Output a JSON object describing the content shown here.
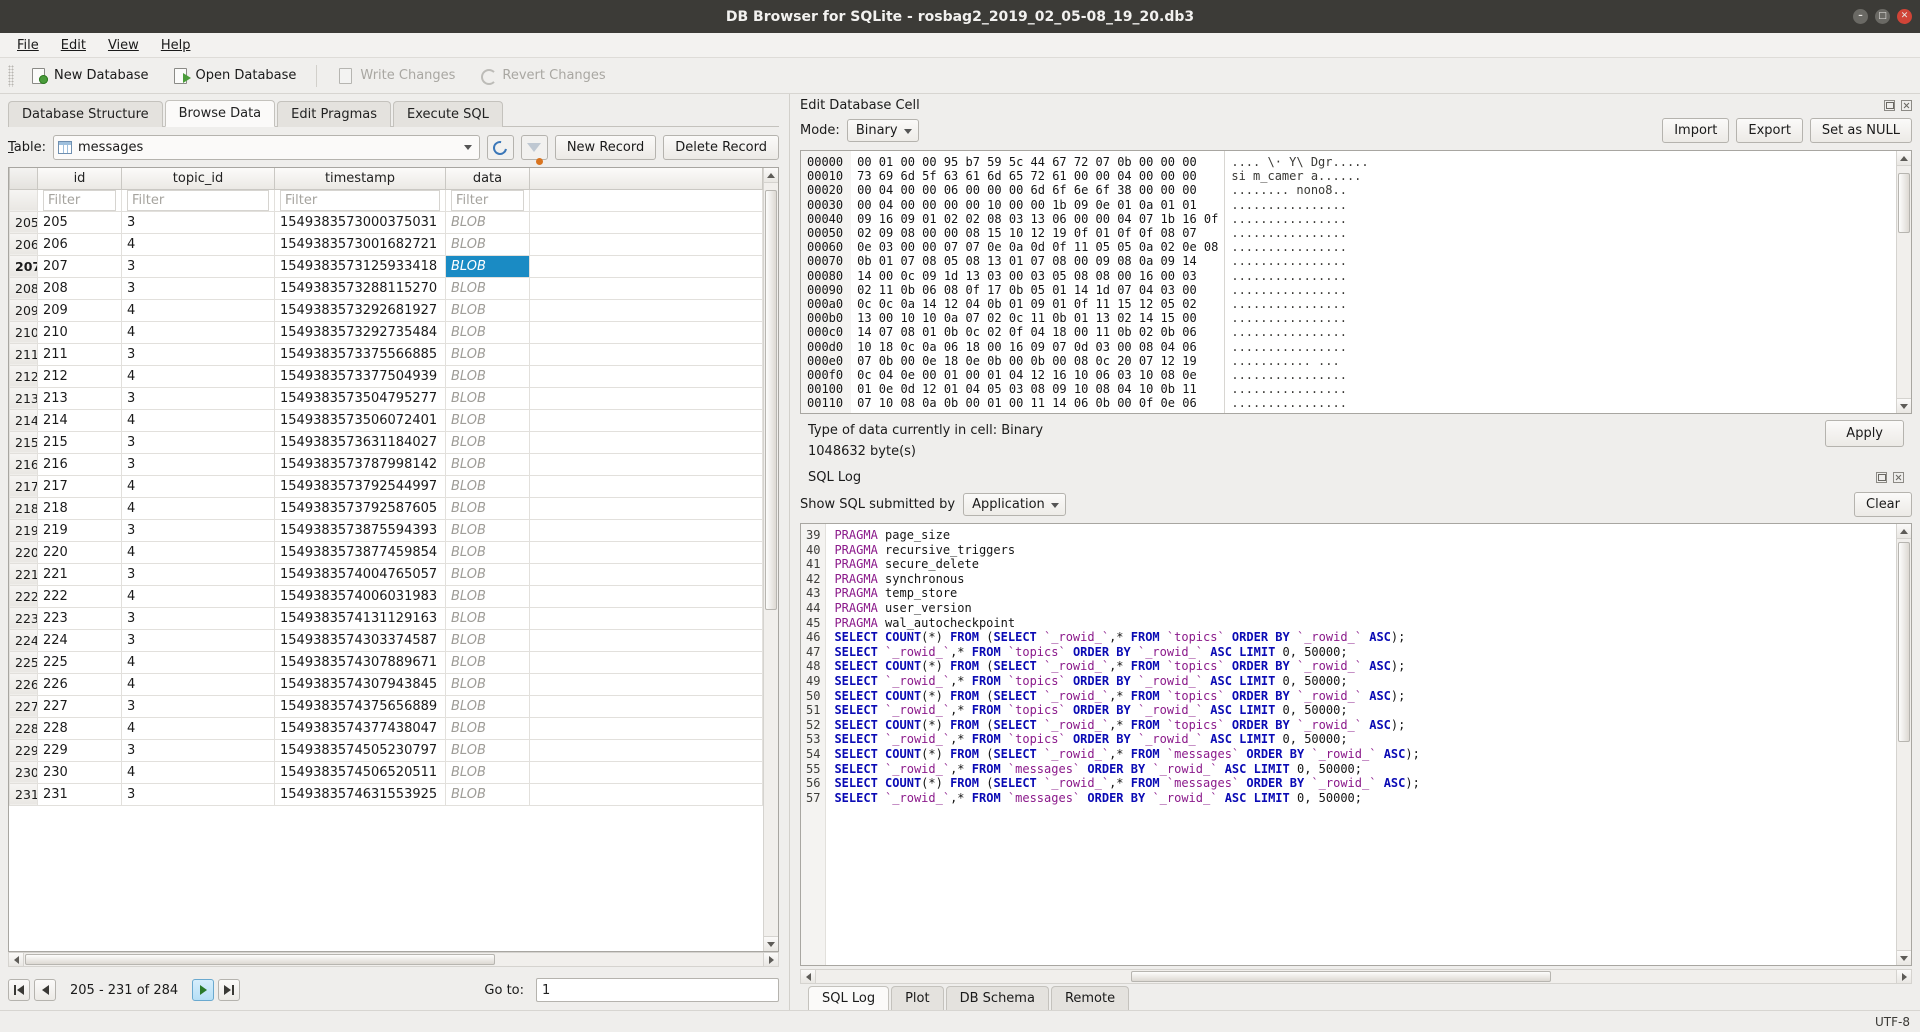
{
  "window": {
    "title": "DB Browser for SQLite - rosbag2_2019_02_05-08_19_20.db3",
    "minimize": "–",
    "maximize": "□",
    "close": "✕"
  },
  "menu": [
    {
      "label": "File",
      "mnemonic": "F"
    },
    {
      "label": "Edit",
      "mnemonic": "E"
    },
    {
      "label": "View",
      "mnemonic": "V"
    },
    {
      "label": "Help",
      "mnemonic": "H"
    }
  ],
  "toolbar": {
    "new_database": "New Database",
    "open_database": "Open Database",
    "write_changes": "Write Changes",
    "revert_changes": "Revert Changes"
  },
  "tabs": [
    {
      "label": "Database Structure",
      "active": false
    },
    {
      "label": "Browse Data",
      "active": true
    },
    {
      "label": "Edit Pragmas",
      "active": false
    },
    {
      "label": "Execute SQL",
      "active": false
    }
  ],
  "browse": {
    "table_label": "Table:",
    "table_value": "messages",
    "refresh_title": "refresh-icon",
    "filter_title": "clear-filters-icon",
    "new_record": "New Record",
    "delete_record": "Delete Record",
    "columns": [
      "id",
      "topic_id",
      "timestamp",
      "data"
    ],
    "filter_placeholder": "Filter",
    "rows": [
      {
        "n": "205",
        "id": "205",
        "topic_id": "3",
        "timestamp": "1549383573000375031",
        "data": "BLOB",
        "selected": false
      },
      {
        "n": "206",
        "id": "206",
        "topic_id": "4",
        "timestamp": "1549383573001682721",
        "data": "BLOB",
        "selected": false
      },
      {
        "n": "207",
        "id": "207",
        "topic_id": "3",
        "timestamp": "1549383573125933418",
        "data": "BLOB",
        "selected": true
      },
      {
        "n": "208",
        "id": "208",
        "topic_id": "3",
        "timestamp": "1549383573288115270",
        "data": "BLOB",
        "selected": false
      },
      {
        "n": "209",
        "id": "209",
        "topic_id": "4",
        "timestamp": "1549383573292681927",
        "data": "BLOB",
        "selected": false
      },
      {
        "n": "210",
        "id": "210",
        "topic_id": "4",
        "timestamp": "1549383573292735484",
        "data": "BLOB",
        "selected": false
      },
      {
        "n": "211",
        "id": "211",
        "topic_id": "3",
        "timestamp": "1549383573375566885",
        "data": "BLOB",
        "selected": false
      },
      {
        "n": "212",
        "id": "212",
        "topic_id": "4",
        "timestamp": "1549383573377504939",
        "data": "BLOB",
        "selected": false
      },
      {
        "n": "213",
        "id": "213",
        "topic_id": "3",
        "timestamp": "1549383573504795277",
        "data": "BLOB",
        "selected": false
      },
      {
        "n": "214",
        "id": "214",
        "topic_id": "4",
        "timestamp": "1549383573506072401",
        "data": "BLOB",
        "selected": false
      },
      {
        "n": "215",
        "id": "215",
        "topic_id": "3",
        "timestamp": "1549383573631184027",
        "data": "BLOB",
        "selected": false
      },
      {
        "n": "216",
        "id": "216",
        "topic_id": "3",
        "timestamp": "1549383573787998142",
        "data": "BLOB",
        "selected": false
      },
      {
        "n": "217",
        "id": "217",
        "topic_id": "4",
        "timestamp": "1549383573792544997",
        "data": "BLOB",
        "selected": false
      },
      {
        "n": "218",
        "id": "218",
        "topic_id": "4",
        "timestamp": "1549383573792587605",
        "data": "BLOB",
        "selected": false
      },
      {
        "n": "219",
        "id": "219",
        "topic_id": "3",
        "timestamp": "1549383573875594393",
        "data": "BLOB",
        "selected": false
      },
      {
        "n": "220",
        "id": "220",
        "topic_id": "4",
        "timestamp": "1549383573877459854",
        "data": "BLOB",
        "selected": false
      },
      {
        "n": "221",
        "id": "221",
        "topic_id": "3",
        "timestamp": "1549383574004765057",
        "data": "BLOB",
        "selected": false
      },
      {
        "n": "222",
        "id": "222",
        "topic_id": "4",
        "timestamp": "1549383574006031983",
        "data": "BLOB",
        "selected": false
      },
      {
        "n": "223",
        "id": "223",
        "topic_id": "3",
        "timestamp": "1549383574131129163",
        "data": "BLOB",
        "selected": false
      },
      {
        "n": "224",
        "id": "224",
        "topic_id": "3",
        "timestamp": "1549383574303374587",
        "data": "BLOB",
        "selected": false
      },
      {
        "n": "225",
        "id": "225",
        "topic_id": "4",
        "timestamp": "1549383574307889671",
        "data": "BLOB",
        "selected": false
      },
      {
        "n": "226",
        "id": "226",
        "topic_id": "4",
        "timestamp": "1549383574307943845",
        "data": "BLOB",
        "selected": false
      },
      {
        "n": "227",
        "id": "227",
        "topic_id": "3",
        "timestamp": "1549383574375656889",
        "data": "BLOB",
        "selected": false
      },
      {
        "n": "228",
        "id": "228",
        "topic_id": "4",
        "timestamp": "1549383574377438047",
        "data": "BLOB",
        "selected": false
      },
      {
        "n": "229",
        "id": "229",
        "topic_id": "3",
        "timestamp": "1549383574505230797",
        "data": "BLOB",
        "selected": false
      },
      {
        "n": "230",
        "id": "230",
        "topic_id": "4",
        "timestamp": "1549383574506520511",
        "data": "BLOB",
        "selected": false
      },
      {
        "n": "231",
        "id": "231",
        "topic_id": "3",
        "timestamp": "1549383574631553925",
        "data": "BLOB",
        "selected": false
      }
    ],
    "nav": {
      "first": "|◀",
      "prev": "◀",
      "next": "▶",
      "last": "▶|",
      "range_text": "205 - 231 of 284",
      "goto_label": "Go to:",
      "goto_value": "1"
    }
  },
  "edit_cell": {
    "panel_title": "Edit Database Cell",
    "mode_label": "Mode:",
    "mode_value": "Binary",
    "import": "Import",
    "export": "Export",
    "set_as_null": "Set as NULL",
    "apply": "Apply",
    "type_text": "Type of data currently in cell: Binary",
    "size_text": "1048632 byte(s)",
    "hex_addresses": "00000\n00010\n00020\n00030\n00040\n00050\n00060\n00070\n00080\n00090\n000a0\n000b0\n000c0\n000d0\n000e0\n000f0\n00100\n00110",
    "hex_bytes": "00 01 00 00 95 b7 59 5c 44 67 72 07 0b 00 00 00\n73 69 6d 5f 63 61 6d 65 72 61 00 00 04 00 00 00\n00 04 00 00 06 00 00 00 6d 6f 6e 6f 38 00 00 00\n00 04 00 00 00 00 10 00 00 1b 09 0e 01 0a 01 01\n09 16 09 01 02 02 08 03 13 06 00 00 04 07 1b 16 0f\n02 09 08 00 00 08 15 10 12 19 0f 01 0f 0f 08 07\n0e 03 00 00 07 07 0e 0a 0d 0f 11 05 05 0a 02 0e 08\n0b 01 07 08 05 08 13 01 07 08 00 09 08 0a 09 14\n14 00 0c 09 1d 13 03 00 03 05 08 08 00 16 00 03\n02 11 0b 06 08 0f 17 0b 05 01 14 1d 07 04 03 00\n0c 0c 0a 14 12 04 0b 01 09 01 0f 11 15 12 05 02\n13 00 10 10 0a 07 02 0c 11 0b 01 13 02 14 15 00\n14 07 08 01 0b 0c 02 0f 04 18 00 11 0b 02 0b 06\n10 18 0c 0a 06 18 00 16 09 07 0d 03 00 08 04 06\n07 0b 00 0e 18 0e 0b 00 0b 00 08 0c 20 07 12 19\n0c 04 0e 00 01 00 01 04 12 16 10 06 03 10 08 0e\n01 0e 0d 12 01 04 05 03 08 09 10 08 04 10 0b 11\n07 10 08 0a 0b 00 01 00 11 14 06 0b 00 0f 0e 06",
    "hex_ascii": ".... \\· Y\\ Dgr.....\nsi m_camer a......\n........ nono8..\n................\n................\n................\n................\n................\n................\n................\n................\n................\n................\n................\n........... ...\n................\n................\n................"
  },
  "sql_log": {
    "panel_title": "SQL Log",
    "show_label": "Show SQL submitted by",
    "show_value": "Application",
    "clear": "Clear",
    "lines": [
      {
        "num": "39",
        "text": "PRAGMA page_size",
        "kind": "pragma"
      },
      {
        "num": "40",
        "text": "PRAGMA recursive_triggers",
        "kind": "pragma"
      },
      {
        "num": "41",
        "text": "PRAGMA secure_delete",
        "kind": "pragma"
      },
      {
        "num": "42",
        "text": "PRAGMA synchronous",
        "kind": "pragma"
      },
      {
        "num": "43",
        "text": "PRAGMA temp_store",
        "kind": "pragma"
      },
      {
        "num": "44",
        "text": "PRAGMA user_version",
        "kind": "pragma"
      },
      {
        "num": "45",
        "text": "PRAGMA wal_autocheckpoint",
        "kind": "pragma"
      },
      {
        "num": "46",
        "text": "SELECT COUNT(*) FROM (SELECT `_rowid_`,* FROM `topics` ORDER BY `_rowid_` ASC);",
        "kind": "sql"
      },
      {
        "num": "47",
        "text": "SELECT `_rowid_`,* FROM `topics` ORDER BY `_rowid_` ASC LIMIT 0, 50000;",
        "kind": "sql"
      },
      {
        "num": "48",
        "text": "SELECT COUNT(*) FROM (SELECT `_rowid_`,* FROM `topics` ORDER BY `_rowid_` ASC);",
        "kind": "sql"
      },
      {
        "num": "49",
        "text": "SELECT `_rowid_`,* FROM `topics` ORDER BY `_rowid_` ASC LIMIT 0, 50000;",
        "kind": "sql"
      },
      {
        "num": "50",
        "text": "SELECT COUNT(*) FROM (SELECT `_rowid_`,* FROM `topics` ORDER BY `_rowid_` ASC);",
        "kind": "sql"
      },
      {
        "num": "51",
        "text": "SELECT `_rowid_`,* FROM `topics` ORDER BY `_rowid_` ASC LIMIT 0, 50000;",
        "kind": "sql"
      },
      {
        "num": "52",
        "text": "SELECT COUNT(*) FROM (SELECT `_rowid_`,* FROM `topics` ORDER BY `_rowid_` ASC);",
        "kind": "sql"
      },
      {
        "num": "53",
        "text": "SELECT `_rowid_`,* FROM `topics` ORDER BY `_rowid_` ASC LIMIT 0, 50000;",
        "kind": "sql"
      },
      {
        "num": "54",
        "text": "SELECT COUNT(*) FROM (SELECT `_rowid_`,* FROM `messages` ORDER BY `_rowid_` ASC);",
        "kind": "sql"
      },
      {
        "num": "55",
        "text": "SELECT `_rowid_`,* FROM `messages` ORDER BY `_rowid_` ASC LIMIT 0, 50000;",
        "kind": "sql"
      },
      {
        "num": "56",
        "text": "SELECT COUNT(*) FROM (SELECT `_rowid_`,* FROM `messages` ORDER BY `_rowid_` ASC);",
        "kind": "sql"
      },
      {
        "num": "57",
        "text": "SELECT `_rowid_`,* FROM `messages` ORDER BY `_rowid_` ASC LIMIT 0, 50000;",
        "kind": "sql"
      }
    ]
  },
  "bottom_tabs": [
    {
      "label": "SQL Log",
      "active": true
    },
    {
      "label": "Plot",
      "active": false
    },
    {
      "label": "DB Schema",
      "active": false
    },
    {
      "label": "Remote",
      "active": false
    }
  ],
  "status": {
    "encoding": "UTF-8"
  },
  "colors": {
    "titlebar_bg": "#3c3b37",
    "accent_selection": "#1a8bc4",
    "close_button": "#d04437",
    "sql_keyword": "#0a0ab4",
    "sql_identifier": "#8b1a8b"
  }
}
